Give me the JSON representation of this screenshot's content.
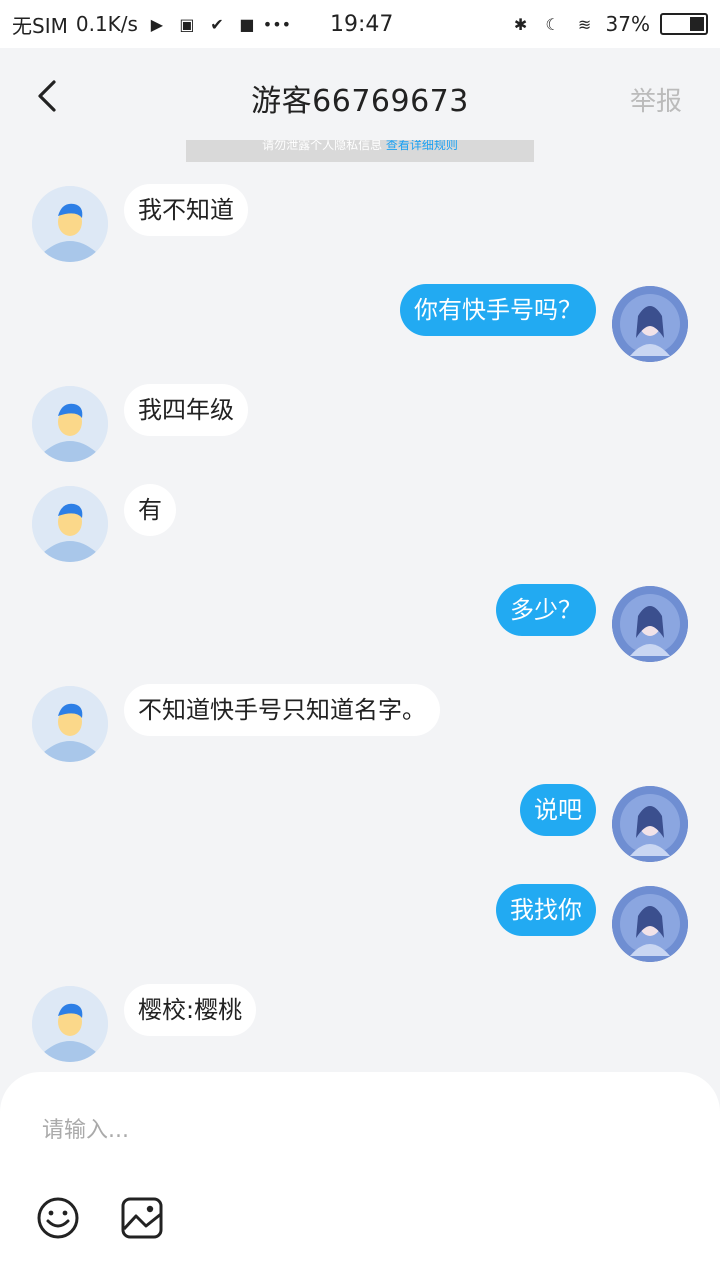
{
  "status_bar": {
    "carrier": "无SIM",
    "speed": "0.1K/s",
    "time": "19:47",
    "battery_text": "37%",
    "battery_level": 0.37
  },
  "header": {
    "title": "游客66769673",
    "report_label": "举报"
  },
  "notice": {
    "text": "请勿泄露个人隐私信息",
    "link": "查看详细规则"
  },
  "messages": [
    {
      "side": "in",
      "text": "我不知道"
    },
    {
      "side": "out",
      "text": "你有快手号吗？"
    },
    {
      "side": "in",
      "text": "我四年级"
    },
    {
      "side": "in",
      "text": "有"
    },
    {
      "side": "out",
      "text": "多少？"
    },
    {
      "side": "in",
      "text": "不知道快手号只知道名字。"
    },
    {
      "side": "out",
      "text": "说吧"
    },
    {
      "side": "out",
      "text": "我找你"
    },
    {
      "side": "in",
      "text": "樱校:樱桃"
    }
  ],
  "composer": {
    "placeholder": "请输入..."
  },
  "colors": {
    "accent": "#22aaf2",
    "background": "#f3f4f6"
  },
  "icons": [
    "back-icon",
    "emoji-icon",
    "image-icon",
    "bluetooth-icon",
    "moon-icon",
    "wifi-icon",
    "battery-icon",
    "video-icon"
  ]
}
